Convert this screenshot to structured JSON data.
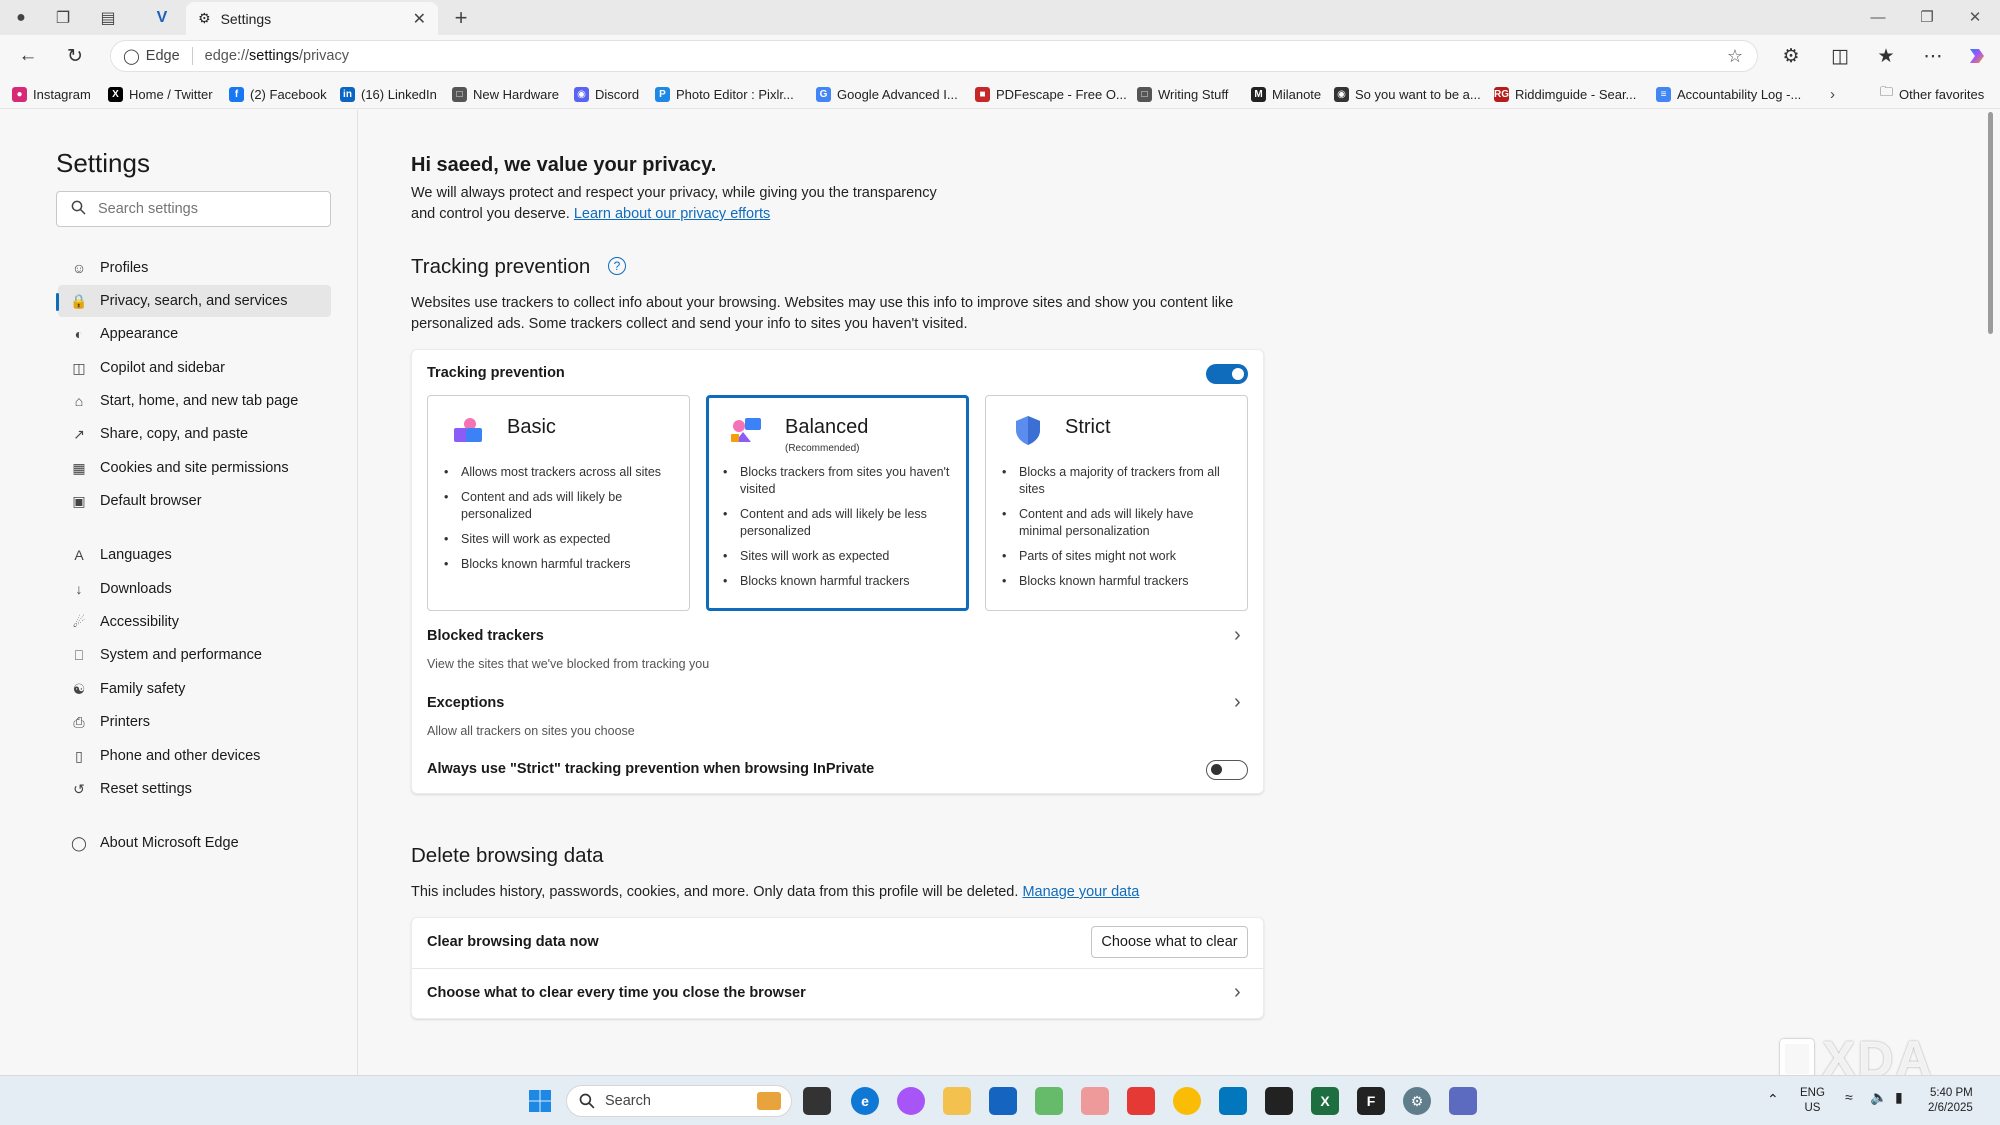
{
  "browser": {
    "tab_title": "Settings",
    "address_label": "Edge",
    "url_prefix": "edge://",
    "url_host": "settings",
    "url_path": "/privacy"
  },
  "favorites": [
    {
      "label": "Instagram",
      "icon": "instagram-icon",
      "color": "#d62976"
    },
    {
      "label": "Home / Twitter",
      "icon": "x-icon",
      "color": "#000000"
    },
    {
      "label": "(2) Facebook",
      "icon": "facebook-icon",
      "color": "#1877f2"
    },
    {
      "label": "(16) LinkedIn",
      "icon": "linkedin-icon",
      "color": "#0a66c2"
    },
    {
      "label": "New Hardware",
      "icon": "folder-icon",
      "color": "#555555"
    },
    {
      "label": "Discord",
      "icon": "discord-icon",
      "color": "#5865f2"
    },
    {
      "label": "Photo Editor : Pixlr...",
      "icon": "pixlr-icon",
      "color": "#1e88e5"
    },
    {
      "label": "Google Advanced I...",
      "icon": "google-icon",
      "color": "#4285f4"
    },
    {
      "label": "PDFescape - Free O...",
      "icon": "pdfescape-icon",
      "color": "#c62828"
    },
    {
      "label": "Writing Stuff",
      "icon": "folder-icon",
      "color": "#555555"
    },
    {
      "label": "Milanote",
      "icon": "milanote-icon",
      "color": "#222222"
    },
    {
      "label": "So you want to be a...",
      "icon": "site-icon",
      "color": "#333333"
    },
    {
      "label": "Riddimguide - Sear...",
      "icon": "rg-icon",
      "color": "#b71c1c"
    },
    {
      "label": "Accountability Log -...",
      "icon": "docs-icon",
      "color": "#4285f4"
    }
  ],
  "favorites_other": "Other favorites",
  "sidebar": {
    "title": "Settings",
    "search_placeholder": "Search settings",
    "items": [
      {
        "label": "Profiles",
        "icon": "profile-icon"
      },
      {
        "label": "Privacy, search, and services",
        "icon": "lock-icon",
        "active": true
      },
      {
        "label": "Appearance",
        "icon": "appearance-icon"
      },
      {
        "label": "Copilot and sidebar",
        "icon": "sidebar-icon"
      },
      {
        "label": "Start, home, and new tab page",
        "icon": "home-icon"
      },
      {
        "label": "Share, copy, and paste",
        "icon": "share-icon"
      },
      {
        "label": "Cookies and site permissions",
        "icon": "cookie-icon"
      },
      {
        "label": "Default browser",
        "icon": "browser-icon"
      },
      {
        "label": "Languages",
        "icon": "language-icon"
      },
      {
        "label": "Downloads",
        "icon": "download-icon"
      },
      {
        "label": "Accessibility",
        "icon": "accessibility-icon"
      },
      {
        "label": "System and performance",
        "icon": "system-icon"
      },
      {
        "label": "Family safety",
        "icon": "family-icon"
      },
      {
        "label": "Printers",
        "icon": "printer-icon"
      },
      {
        "label": "Phone and other devices",
        "icon": "phone-icon"
      },
      {
        "label": "Reset settings",
        "icon": "reset-icon"
      },
      {
        "label": "About Microsoft Edge",
        "icon": "edge-icon"
      }
    ]
  },
  "main": {
    "greeting": "Hi saeed, we value your privacy.",
    "intro_line1": "We will always protect and respect your privacy, while giving you the transparency",
    "intro_line2": "and control you deserve.",
    "intro_link": "Learn about our privacy efforts",
    "tracking": {
      "heading": "Tracking prevention",
      "description_line1": "Websites use trackers to collect info about your browsing. Websites may use this info to improve sites and show you content like",
      "description_line2": "personalized ads. Some trackers collect and send your info to sites you haven't visited.",
      "toggle_label": "Tracking prevention",
      "enabled": true,
      "options": [
        {
          "name": "Basic",
          "subtitle": "",
          "selected": false,
          "bullets": [
            "Allows most trackers across all sites",
            "Content and ads will likely be personalized",
            "Sites will work as expected",
            "Blocks known harmful trackers"
          ]
        },
        {
          "name": "Balanced",
          "subtitle": "(Recommended)",
          "selected": true,
          "bullets": [
            "Blocks trackers from sites you haven't visited",
            "Content and ads will likely be less personalized",
            "Sites will work as expected",
            "Blocks known harmful trackers"
          ]
        },
        {
          "name": "Strict",
          "subtitle": "",
          "selected": false,
          "bullets": [
            "Blocks a majority of trackers from all sites",
            "Content and ads will likely have minimal personalization",
            "Parts of sites might not work",
            "Blocks known harmful trackers"
          ]
        }
      ],
      "blocked_title": "Blocked trackers",
      "blocked_sub": "View the sites that we've blocked from tracking you",
      "exceptions_title": "Exceptions",
      "exceptions_sub": "Allow all trackers on sites you choose",
      "inprivate_label": "Always use \"Strict\" tracking prevention when browsing InPrivate",
      "inprivate_enabled": false
    },
    "delete": {
      "heading": "Delete browsing data",
      "description": "This includes history, passwords, cookies, and more. Only data from this profile will be deleted.",
      "link": "Manage your data",
      "clear_now": "Clear browsing data now",
      "choose_button": "Choose what to clear",
      "clear_on_close": "Choose what to clear every time you close the browser"
    }
  },
  "taskbar": {
    "search_placeholder": "Search",
    "lang_line1": "ENG",
    "lang_line2": "US",
    "time": "5:40 PM",
    "date": "2/6/2025"
  },
  "watermark": "XDA",
  "colors": {
    "accent": "#0f6cbd",
    "link": "#0f6cbd"
  }
}
